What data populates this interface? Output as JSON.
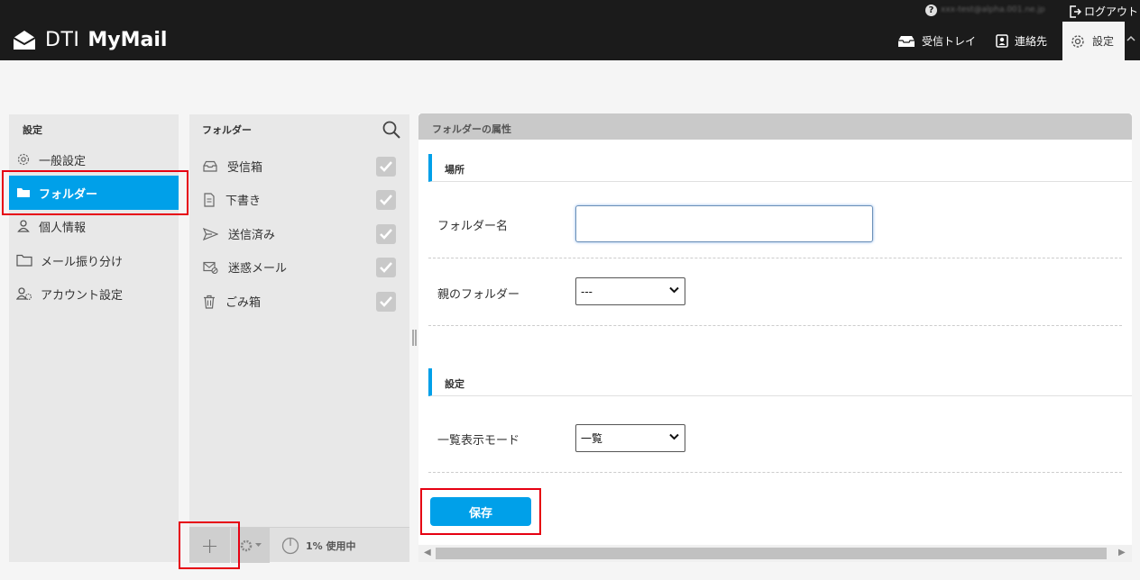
{
  "app": {
    "brand_part1": "DTI",
    "brand_part2": "MyMail"
  },
  "topbar": {
    "help": "?",
    "user_email": "xxx-test@alpha.001.ne.jp",
    "logout": "ログアウト"
  },
  "nav": {
    "inbox": "受信トレイ",
    "contacts": "連絡先",
    "settings": "設定"
  },
  "sidebar": {
    "title": "設定",
    "items": [
      {
        "label": "一般設定",
        "icon": "gear-icon"
      },
      {
        "label": "フォルダー",
        "icon": "folder-icon"
      },
      {
        "label": "個人情報",
        "icon": "person-icon"
      },
      {
        "label": "メール振り分け",
        "icon": "folder-outline-icon"
      },
      {
        "label": "アカウント設定",
        "icon": "account-gear-icon"
      }
    ]
  },
  "folders": {
    "title": "フォルダー",
    "items": [
      {
        "label": "受信箱",
        "icon": "inbox-icon"
      },
      {
        "label": "下書き",
        "icon": "document-icon"
      },
      {
        "label": "送信済み",
        "icon": "send-icon"
      },
      {
        "label": "迷惑メール",
        "icon": "spam-icon"
      },
      {
        "label": "ごみ箱",
        "icon": "trash-icon"
      }
    ],
    "add": "+",
    "usage": "1% 使用中"
  },
  "properties": {
    "title": "フォルダーの属性",
    "section_location": "場所",
    "folder_name_label": "フォルダー名",
    "folder_name_value": "",
    "parent_label": "親のフォルダー",
    "parent_value": "---",
    "section_settings": "設定",
    "display_mode_label": "一覧表示モード",
    "display_mode_value": "一覧",
    "save": "保存"
  },
  "colors": {
    "accent": "#00a0e9",
    "header": "#1b1b1b",
    "highlight": "#e60012"
  }
}
